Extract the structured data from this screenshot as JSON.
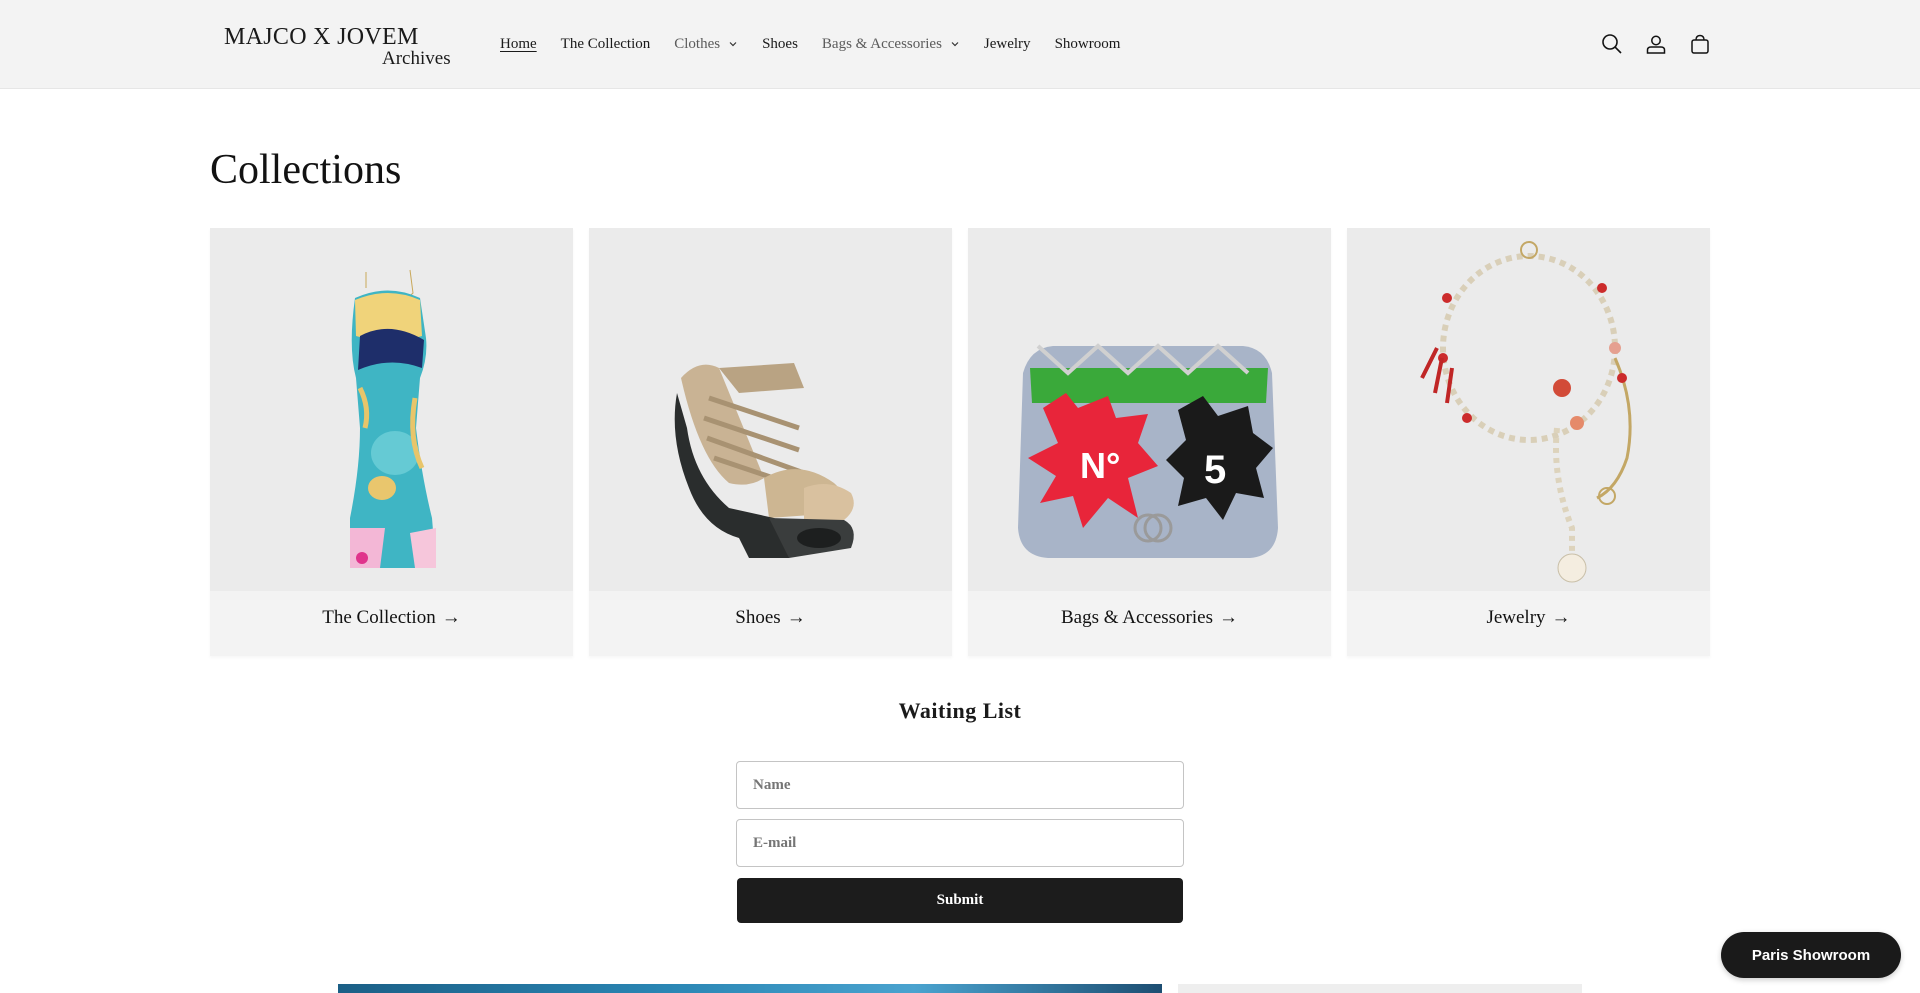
{
  "logo": {
    "line1": "MAJCO X JOVEM",
    "line2": "Archives"
  },
  "nav": {
    "items": [
      {
        "label": "Home",
        "active": true
      },
      {
        "label": "The Collection"
      },
      {
        "label": "Clothes",
        "dropdown": true
      },
      {
        "label": "Shoes"
      },
      {
        "label": "Bags & Accessories",
        "dropdown": true
      },
      {
        "label": "Jewelry"
      },
      {
        "label": "Showroom"
      }
    ]
  },
  "header_icons": [
    "search-icon",
    "account-icon",
    "cart-icon"
  ],
  "page": {
    "title": "Collections"
  },
  "collections": [
    {
      "label": "The Collection",
      "arrow": "→",
      "image": "dress"
    },
    {
      "label": "Shoes",
      "arrow": "→",
      "image": "heels"
    },
    {
      "label": "Bags & Accessories",
      "arrow": "→",
      "image": "handbag"
    },
    {
      "label": "Jewelry",
      "arrow": "→",
      "image": "necklace"
    }
  ],
  "waiting_list": {
    "title": "Waiting List",
    "name_placeholder": "Name",
    "email_placeholder": "E-mail",
    "submit_label": "Submit"
  },
  "floating_button": {
    "label": "Paris Showroom"
  },
  "colors": {
    "header_bg": "#f3f3f3",
    "card_bg": "#ebebeb",
    "button_dark": "#1c1c1c"
  }
}
